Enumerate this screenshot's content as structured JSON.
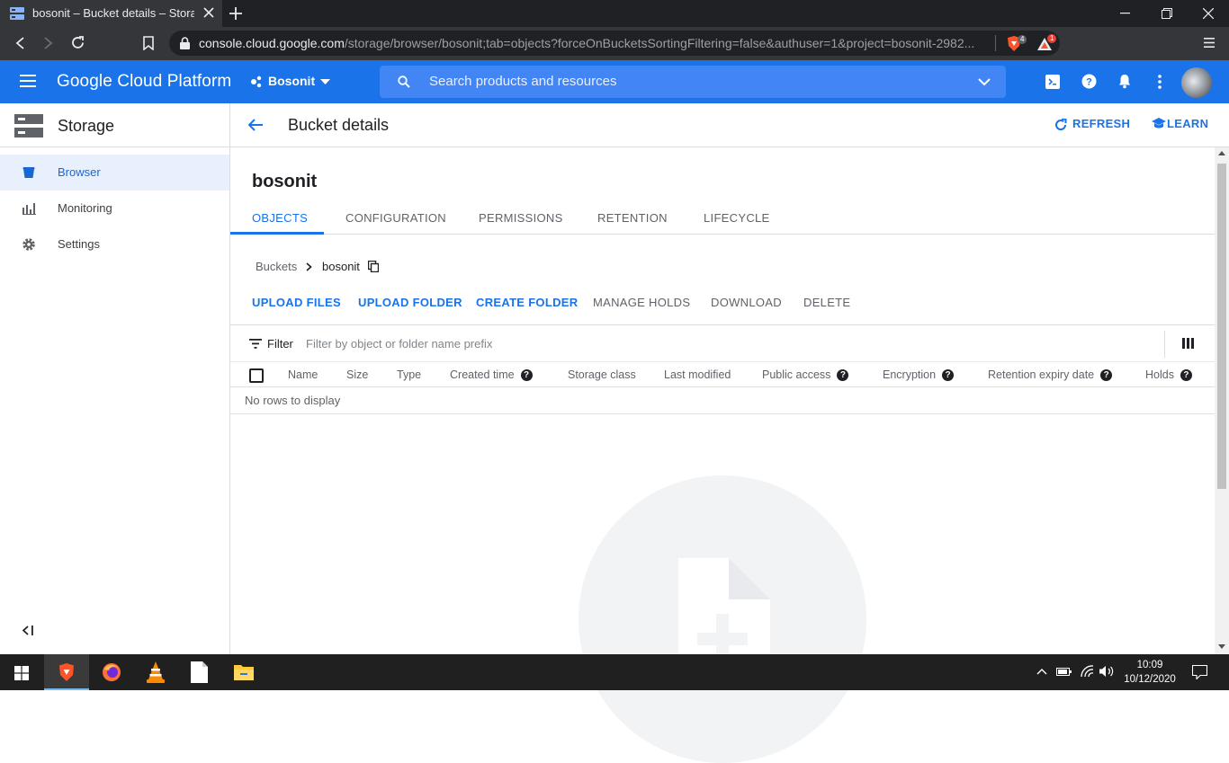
{
  "browser": {
    "tab_title": "bosonit – Bucket details – Storage",
    "url_host": "console.cloud.google.com",
    "url_path": "/storage/browser/bosonit;tab=objects?forceOnBucketsSortingFiltering=false&authuser=1&project=bosonit-2982...",
    "brave_badge": "4",
    "alert_badge": "1"
  },
  "header": {
    "brand": "Google Cloud Platform",
    "project": "Bosonit",
    "search_placeholder": "Search products and resources"
  },
  "sidebar": {
    "title": "Storage",
    "items": [
      {
        "label": "Browser",
        "icon": "bucket-icon",
        "active": true
      },
      {
        "label": "Monitoring",
        "icon": "monitoring-icon",
        "active": false
      },
      {
        "label": "Settings",
        "icon": "gear-icon",
        "active": false
      }
    ]
  },
  "page": {
    "title": "Bucket details",
    "refresh_label": "REFRESH",
    "learn_label": "LEARN",
    "bucket_name": "bosonit",
    "tabs": [
      "OBJECTS",
      "CONFIGURATION",
      "PERMISSIONS",
      "RETENTION",
      "LIFECYCLE"
    ],
    "breadcrumb": {
      "root": "Buckets",
      "current": "bosonit"
    },
    "actions": {
      "upload_files": "UPLOAD FILES",
      "upload_folder": "UPLOAD FOLDER",
      "create_folder": "CREATE FOLDER",
      "manage_holds": "MANAGE HOLDS",
      "download": "DOWNLOAD",
      "delete": "DELETE"
    },
    "filter": {
      "label": "Filter",
      "placeholder": "Filter by object or folder name prefix"
    },
    "columns": [
      "Name",
      "Size",
      "Type",
      "Created time",
      "Storage class",
      "Last modified",
      "Public access",
      "Encryption",
      "Retention expiry date",
      "Holds"
    ],
    "empty_text": "No rows to display"
  },
  "taskbar": {
    "time": "10:09",
    "date": "10/12/2020"
  },
  "colors": {
    "accent": "#1a73e8",
    "header": "#1a73e8"
  }
}
